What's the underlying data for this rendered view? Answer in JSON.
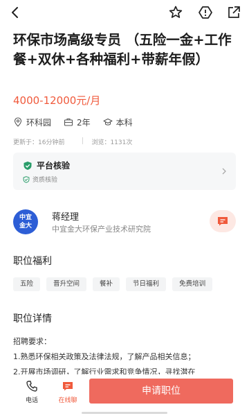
{
  "job": {
    "title": "环保市场高级专员 （五险一金+工作餐+双休+各种福利+带薪年假）",
    "salary": "4000-12000元/月",
    "location": "环科园",
    "experience": "2年",
    "education": "本科"
  },
  "meta": {
    "updated": "更新于：16分钟前",
    "views": "浏览：1131次"
  },
  "verify": {
    "title": "平台核验",
    "sub": "资质核验"
  },
  "company": {
    "logo_text_1": "中宜",
    "logo_text_2": "金大",
    "contact": "蒋经理",
    "org": "中宜金大环保产业技术研究院"
  },
  "benefits": {
    "heading": "职位福利",
    "items": [
      "五险",
      "晋升空间",
      "餐补",
      "节日福利",
      "免费培训"
    ]
  },
  "details": {
    "heading": "职位详情",
    "lines": [
      "招聘要求：",
      "1.熟悉环保相关政策及法律法规，了解产品相关信息；",
      "2.开展市场调研，了解行业需求和竞争情况，寻找潜在"
    ]
  },
  "bottom": {
    "phone_label": "电话",
    "online_label": "在线聊",
    "apply_label": "申请职位"
  },
  "colors": {
    "accent": "#f05a3c",
    "apply": "#ef6a5e",
    "logo": "#2d5ed6"
  },
  "icons": [
    "back-arrow-icon",
    "star-icon",
    "report-icon",
    "share-icon",
    "location-icon",
    "briefcase-icon",
    "graduation-cap-icon",
    "shield-check-icon",
    "chevron-right-icon",
    "chat-bubble-icon",
    "phone-icon"
  ]
}
